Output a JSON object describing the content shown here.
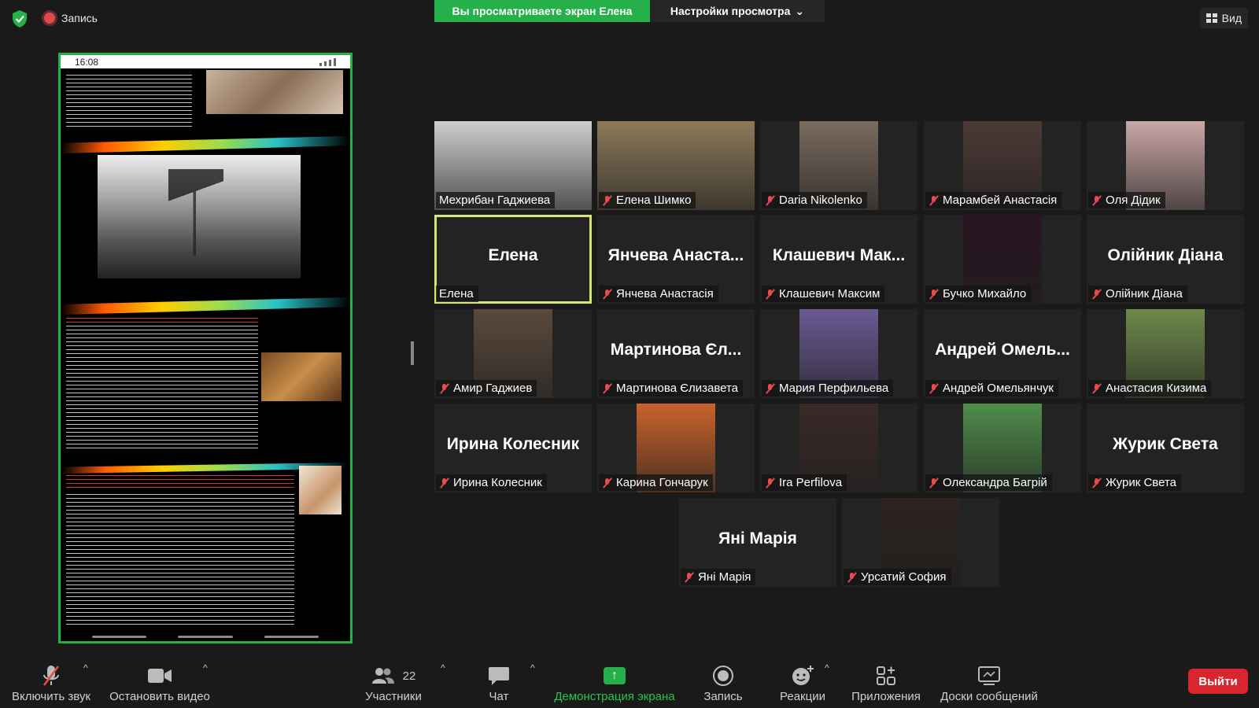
{
  "top": {
    "recording_label": "Запись",
    "sharing_banner": "Вы просматриваете экран Елена",
    "view_settings": "Настройки просмотра",
    "view_button": "Вид"
  },
  "shared_screen": {
    "phone_time": "16:08"
  },
  "participants": [
    {
      "big": "",
      "label": "Мехрибан Гаджиева",
      "muted": false,
      "video": "#cfcfcf"
    },
    {
      "big": "",
      "label": "Елена Шимко",
      "muted": true,
      "video": "#8d7a5a"
    },
    {
      "big": "",
      "label": "Daria Nikolenko",
      "muted": true,
      "video": "#7a6b5e"
    },
    {
      "big": "",
      "label": "Марамбей Анастасія",
      "muted": true,
      "video": "#4c3a36"
    },
    {
      "big": "",
      "label": "Оля Дідик",
      "muted": true,
      "video": "#caa7a6"
    },
    {
      "big": "Елена",
      "label": "Елена",
      "muted": false,
      "video": ""
    },
    {
      "big": "Янчева  Анаста...",
      "label": "Янчева Анастасія",
      "muted": true,
      "video": ""
    },
    {
      "big": "Клашевич  Мак...",
      "label": "Клашевич Максим",
      "muted": true,
      "video": ""
    },
    {
      "big": "",
      "label": "Бучко Михайло",
      "muted": true,
      "video": "#2a1522"
    },
    {
      "big": "Олійник Діана",
      "label": "Олійник Діана",
      "muted": true,
      "video": ""
    },
    {
      "big": "",
      "label": "Амир Гаджиев",
      "muted": true,
      "video": "#5b4a3c"
    },
    {
      "big": "Мартинова Єл...",
      "label": "Мартинова Єлизавета",
      "muted": true,
      "video": ""
    },
    {
      "big": "",
      "label": "Мария Перфильева",
      "muted": true,
      "video": "#6a5a92"
    },
    {
      "big": "Андрей  Омель...",
      "label": "Андрей Омельянчук",
      "muted": true,
      "video": ""
    },
    {
      "big": "",
      "label": "Анастасия Кизима",
      "muted": true,
      "video": "#6f8a4a"
    },
    {
      "big": "Ирина Колесник",
      "label": "Ирина Колесник",
      "muted": true,
      "video": ""
    },
    {
      "big": "",
      "label": "Карина Гончарук",
      "muted": true,
      "video": "#c9632b"
    },
    {
      "big": "",
      "label": "Ira Perfilova",
      "muted": true,
      "video": "#3a2a28"
    },
    {
      "big": "",
      "label": "Олександра Багрій",
      "muted": true,
      "video": "#4f8d4b"
    },
    {
      "big": "Журик Света",
      "label": "Журик Света",
      "muted": true,
      "video": ""
    },
    {
      "big": "Яні Марія",
      "label": "Яні Марія",
      "muted": true,
      "video": ""
    },
    {
      "big": "",
      "label": "Урсатий София",
      "muted": true,
      "video": "#2d2320"
    }
  ],
  "toolbar": {
    "audio": "Включить звук",
    "video": "Остановить видео",
    "participants": "Участники",
    "participants_count": "22",
    "chat": "Чат",
    "share": "Демонстрация экрана",
    "record": "Запись",
    "reactions": "Реакции",
    "apps": "Приложения",
    "whiteboards": "Доски сообщений",
    "leave": "Выйти"
  },
  "colors": {
    "accent_green": "#26b04a",
    "active_speaker": "#d9e56c",
    "leave_red": "#d9252d"
  }
}
